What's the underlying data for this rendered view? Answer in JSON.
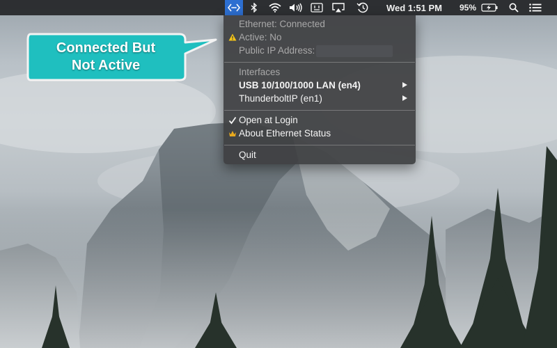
{
  "menubar": {
    "clock": "Wed 1:51 PM",
    "battery_percent": "95%",
    "icons": [
      "ethernet-status-icon",
      "bluetooth-icon",
      "wifi-icon",
      "volume-icon",
      "keyboard-input-icon",
      "airplay-icon",
      "time-machine-icon",
      "battery-charging-icon",
      "spotlight-search-icon",
      "notification-center-icon"
    ]
  },
  "menu": {
    "status_connected": "Ethernet: Connected",
    "status_active": "Active: No",
    "public_ip_label": "Public IP Address:",
    "interfaces_header": "Interfaces",
    "interfaces": [
      {
        "label": "USB 10/100/1000 LAN (en4)"
      },
      {
        "label": "ThunderboltIP (en1)"
      }
    ],
    "open_at_login": "Open at Login",
    "open_at_login_checked": true,
    "about": "About Ethernet Status",
    "quit": "Quit"
  },
  "callout": {
    "line1": "Connected But",
    "line2": "Not Active",
    "fill_color": "#1fbfbf"
  },
  "colors": {
    "highlight": "#2d6fd1",
    "warning": "#f5c518",
    "crown": "#e8a91e"
  }
}
